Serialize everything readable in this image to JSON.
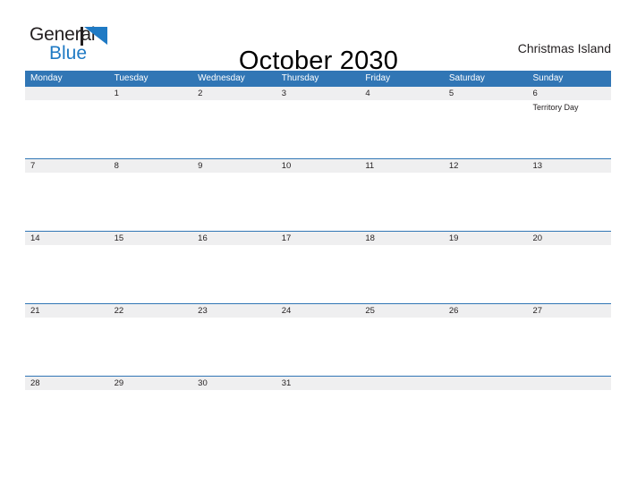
{
  "logo": {
    "word_one": "General",
    "word_two": "Blue",
    "mark": "triangle-mark",
    "brand_color": "#1f7ac4"
  },
  "header": {
    "title": "October 2030",
    "location": "Christmas Island"
  },
  "theme": {
    "header_blue": "#3176b5",
    "band_gray": "#efeff0",
    "text_dark": "#231f20"
  },
  "calendar": {
    "weekdays": [
      "Monday",
      "Tuesday",
      "Wednesday",
      "Thursday",
      "Friday",
      "Saturday",
      "Sunday"
    ],
    "weeks": [
      {
        "days": [
          {
            "num": "",
            "events": []
          },
          {
            "num": "1",
            "events": []
          },
          {
            "num": "2",
            "events": []
          },
          {
            "num": "3",
            "events": []
          },
          {
            "num": "4",
            "events": []
          },
          {
            "num": "5",
            "events": []
          },
          {
            "num": "6",
            "events": [
              "Territory Day"
            ]
          }
        ]
      },
      {
        "days": [
          {
            "num": "7",
            "events": []
          },
          {
            "num": "8",
            "events": []
          },
          {
            "num": "9",
            "events": []
          },
          {
            "num": "10",
            "events": []
          },
          {
            "num": "11",
            "events": []
          },
          {
            "num": "12",
            "events": []
          },
          {
            "num": "13",
            "events": []
          }
        ]
      },
      {
        "days": [
          {
            "num": "14",
            "events": []
          },
          {
            "num": "15",
            "events": []
          },
          {
            "num": "16",
            "events": []
          },
          {
            "num": "17",
            "events": []
          },
          {
            "num": "18",
            "events": []
          },
          {
            "num": "19",
            "events": []
          },
          {
            "num": "20",
            "events": []
          }
        ]
      },
      {
        "days": [
          {
            "num": "21",
            "events": []
          },
          {
            "num": "22",
            "events": []
          },
          {
            "num": "23",
            "events": []
          },
          {
            "num": "24",
            "events": []
          },
          {
            "num": "25",
            "events": []
          },
          {
            "num": "26",
            "events": []
          },
          {
            "num": "27",
            "events": []
          }
        ]
      },
      {
        "days": [
          {
            "num": "28",
            "events": []
          },
          {
            "num": "29",
            "events": []
          },
          {
            "num": "30",
            "events": []
          },
          {
            "num": "31",
            "events": []
          },
          {
            "num": "",
            "events": []
          },
          {
            "num": "",
            "events": []
          },
          {
            "num": "",
            "events": []
          }
        ]
      }
    ]
  }
}
